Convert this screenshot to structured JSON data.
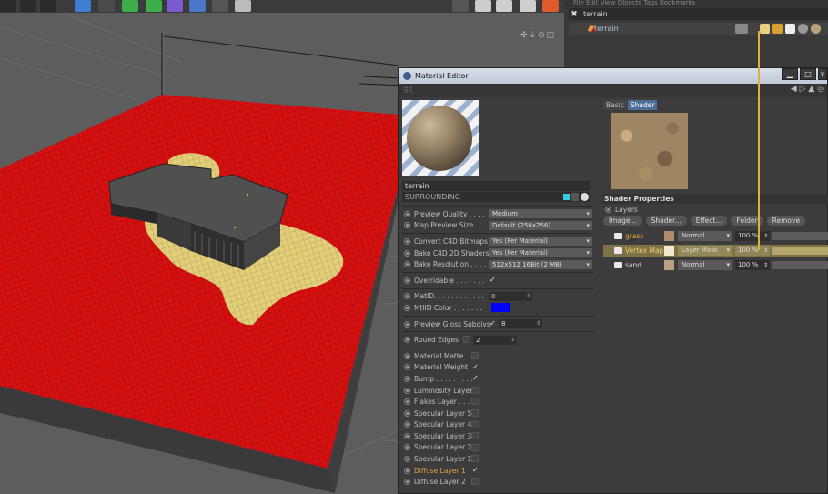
{
  "object_manager": {
    "menu": "File  Edit  View  Objects  Tags  Bookmarks",
    "search_value": "terrain",
    "object_name": "terrain"
  },
  "material_editor": {
    "title": "Material Editor",
    "material_name": "terrain",
    "material_sub": "SURROUNDING",
    "settings_group1": [
      {
        "label": "Preview Quality . . . .",
        "value": "Medium"
      },
      {
        "label": "Map Preview Size . . .",
        "value": "Default (256x256)"
      }
    ],
    "settings_group2": [
      {
        "label": "Convert C4D Bitmaps",
        "value": "Yes (Per Material)"
      },
      {
        "label": "Bake C4D 2D Shaders",
        "value": "Yes (Per Material)"
      },
      {
        "label": "Bake Resolution . . . .",
        "value": "512x512  16Bit  (2 MB)"
      }
    ],
    "overridable": {
      "label": "Overridable . . . . . . .",
      "checked": "✓"
    },
    "matid": {
      "label": "MatID. . . . . . . . . . . .",
      "value": "0"
    },
    "mtlid_color": {
      "label": "MtlID Color . . . . . . .",
      "color": "#0000ff"
    },
    "preview_gloss": {
      "label": "Preview Gloss Subdivs",
      "checked": "✓",
      "value": "8"
    },
    "round_edges": {
      "label": "Round Edges",
      "value": "2"
    },
    "layers_list": [
      {
        "label": "Material Matte",
        "checked": ""
      },
      {
        "label": "Material Weight",
        "checked": "✓"
      },
      {
        "label": "Bump . . . . . . . . .",
        "checked": "✓"
      },
      {
        "label": "Luminosity Layer",
        "checked": ""
      },
      {
        "label": "Flakes Layer . . . .",
        "checked": ""
      },
      {
        "label": "Specular Layer 5",
        "checked": ""
      },
      {
        "label": "Specular Layer 4",
        "checked": ""
      },
      {
        "label": "Specular Layer 3",
        "checked": ""
      },
      {
        "label": "Specular Layer 2",
        "checked": ""
      },
      {
        "label": "Specular Layer 1",
        "checked": ""
      },
      {
        "label": "Diffuse Layer 1",
        "checked": "✓",
        "highlight": true
      },
      {
        "label": "Diffuse Layer 2",
        "checked": ""
      }
    ],
    "tabs": [
      "Basic",
      "Shader"
    ],
    "active_tab": "Shader",
    "shader_properties": {
      "header": "Shader Properties",
      "layers_label": "Layers",
      "buttons": [
        "Image...",
        "Shader...",
        "Effect...",
        "Folder",
        "Remove"
      ],
      "layers": [
        {
          "name": "grass",
          "mode": "Normal",
          "opacity": "100 %",
          "swatch": "#b08d6a",
          "name_color": "#e8a33c",
          "selected": false
        },
        {
          "name": "Vertex Map",
          "mode": "Layer Mask",
          "opacity": "100 %",
          "swatch": "#f2ead0",
          "name_color": "#f0d070",
          "selected": true
        },
        {
          "name": "sand",
          "mode": "Normal",
          "opacity": "100 %",
          "swatch": "#b8a080",
          "name_color": "#dddddd",
          "selected": false
        }
      ]
    }
  },
  "colors": {
    "accent_tab": "#4c6f9a",
    "highlight_orange": "#e8a33c",
    "link_line": "#e0b038",
    "terrain_red": "#d41010",
    "terrain_yellow": "#e3cf78"
  }
}
